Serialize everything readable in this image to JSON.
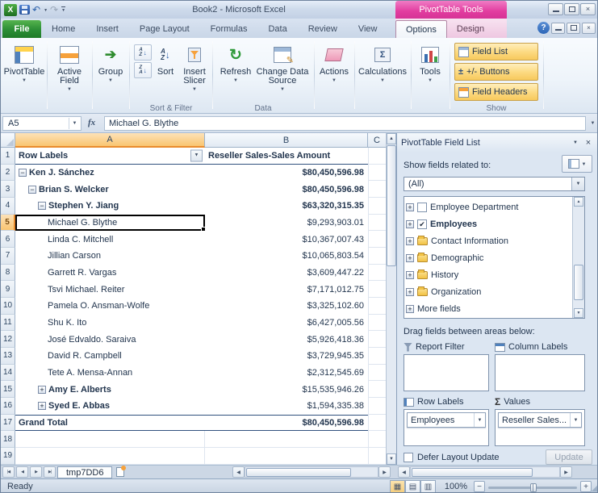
{
  "titlebar": {
    "title": "Book2 - Microsoft Excel",
    "contextual": "PivotTable Tools"
  },
  "tabs": {
    "file": "File",
    "items": [
      "Home",
      "Insert",
      "Page Layout",
      "Formulas",
      "Data",
      "Review",
      "View"
    ],
    "contextual": [
      "Options",
      "Design"
    ],
    "active": "Options"
  },
  "ribbon": {
    "pivottable": "PivotTable",
    "active_field": "Active Field",
    "group": "Group",
    "sort": "Sort",
    "insert_slicer": "Insert Slicer",
    "sort_filter_group": "Sort & Filter",
    "refresh": "Refresh",
    "change_data_source": "Change Data Source",
    "data_group": "Data",
    "actions": "Actions",
    "calculations": "Calculations",
    "tools": "Tools",
    "field_list": "Field List",
    "plus_minus_buttons": "+/- Buttons",
    "field_headers": "Field Headers",
    "show_group": "Show"
  },
  "formula_bar": {
    "name_box": "A5",
    "fx": "fx",
    "content": "Michael G. Blythe"
  },
  "grid": {
    "col_headers": [
      "A",
      "B",
      "C"
    ],
    "rows": [
      {
        "n": 1,
        "type": "header",
        "label": "Row Labels",
        "value": "Reseller Sales-Sales Amount"
      },
      {
        "n": 2,
        "type": "item",
        "label": "Ken J. Sánchez",
        "value": "$80,450,596.98",
        "level": 0,
        "toggle": "minus",
        "lb": true,
        "vb": true
      },
      {
        "n": 3,
        "type": "item",
        "label": "Brian S. Welcker",
        "value": "$80,450,596.98",
        "level": 1,
        "toggle": "minus",
        "lb": true,
        "vb": true
      },
      {
        "n": 4,
        "type": "item",
        "label": "Stephen Y. Jiang",
        "value": "$63,320,315.35",
        "level": 2,
        "toggle": "minus",
        "lb": true,
        "vb": true
      },
      {
        "n": 5,
        "type": "item",
        "label": "Michael G. Blythe",
        "value": "$9,293,903.01",
        "level": 3,
        "sel": true
      },
      {
        "n": 6,
        "type": "item",
        "label": "Linda C. Mitchell",
        "value": "$10,367,007.43",
        "level": 3
      },
      {
        "n": 7,
        "type": "item",
        "label": "Jillian Carson",
        "value": "$10,065,803.54",
        "level": 3
      },
      {
        "n": 8,
        "type": "item",
        "label": "Garrett R. Vargas",
        "value": "$3,609,447.22",
        "level": 3
      },
      {
        "n": 9,
        "type": "item",
        "label": "Tsvi Michael. Reiter",
        "value": "$7,171,012.75",
        "level": 3
      },
      {
        "n": 10,
        "type": "item",
        "label": "Pamela O. Ansman-Wolfe",
        "value": "$3,325,102.60",
        "level": 3
      },
      {
        "n": 11,
        "type": "item",
        "label": "Shu K. Ito",
        "value": "$6,427,005.56",
        "level": 3
      },
      {
        "n": 12,
        "type": "item",
        "label": "José Edvaldo. Saraiva",
        "value": "$5,926,418.36",
        "level": 3
      },
      {
        "n": 13,
        "type": "item",
        "label": "David R. Campbell",
        "value": "$3,729,945.35",
        "level": 3
      },
      {
        "n": 14,
        "type": "item",
        "label": "Tete A. Mensa-Annan",
        "value": "$2,312,545.69",
        "level": 3
      },
      {
        "n": 15,
        "type": "item",
        "label": "Amy E. Alberts",
        "value": "$15,535,946.26",
        "level": 2,
        "toggle": "plus",
        "lb": true
      },
      {
        "n": 16,
        "type": "item",
        "label": "Syed E. Abbas",
        "value": "$1,594,335.38",
        "level": 2,
        "toggle": "plus",
        "lb": true
      },
      {
        "n": 17,
        "type": "total",
        "label": "Grand Total",
        "value": "$80,450,596.98",
        "level": 0,
        "lb": true,
        "vb": true
      },
      {
        "n": 18,
        "type": "empty"
      },
      {
        "n": 19,
        "type": "empty"
      }
    ]
  },
  "pane": {
    "title": "PivotTable Field List",
    "show_fields_label": "Show fields related to:",
    "source_filter": "(All)",
    "fields": [
      {
        "label": "Employee Department",
        "type": "check",
        "checked": false
      },
      {
        "label": "Employees",
        "type": "check",
        "checked": true,
        "bold": true
      },
      {
        "label": "Contact Information",
        "type": "folder"
      },
      {
        "label": "Demographic",
        "type": "folder"
      },
      {
        "label": "History",
        "type": "folder"
      },
      {
        "label": "Organization",
        "type": "folder"
      },
      {
        "label": "More fields",
        "type": "more"
      }
    ],
    "drag_label": "Drag fields between areas below:",
    "areas": {
      "report_filter": {
        "label": "Report Filter",
        "items": []
      },
      "column_labels": {
        "label": "Column Labels",
        "items": []
      },
      "row_labels": {
        "label": "Row Labels",
        "items": [
          "Employees"
        ]
      },
      "values": {
        "label": "Values",
        "items": [
          "Reseller Sales..."
        ]
      }
    },
    "defer_label": "Defer Layout Update",
    "update_label": "Update"
  },
  "sheet": {
    "tabs": [
      "tmp7DD6"
    ]
  },
  "status": {
    "ready": "Ready",
    "zoom": "100%"
  },
  "icons": {
    "app": "X",
    "dropdown": "▼",
    "up": "▲",
    "undo": "↶",
    "redo": "↷",
    "refresh": "↻",
    "sigma": "Σ",
    "close": "×",
    "help": "?",
    "letter_a": "A",
    "letter_z": "Z",
    "arrow_down": "↓",
    "check": "✔",
    "left": "◀",
    "right": "▶",
    "first": "|◀",
    "last": "▶|",
    "minus": "−",
    "plus": "+",
    "pencil": "✎",
    "grip": "◢"
  }
}
